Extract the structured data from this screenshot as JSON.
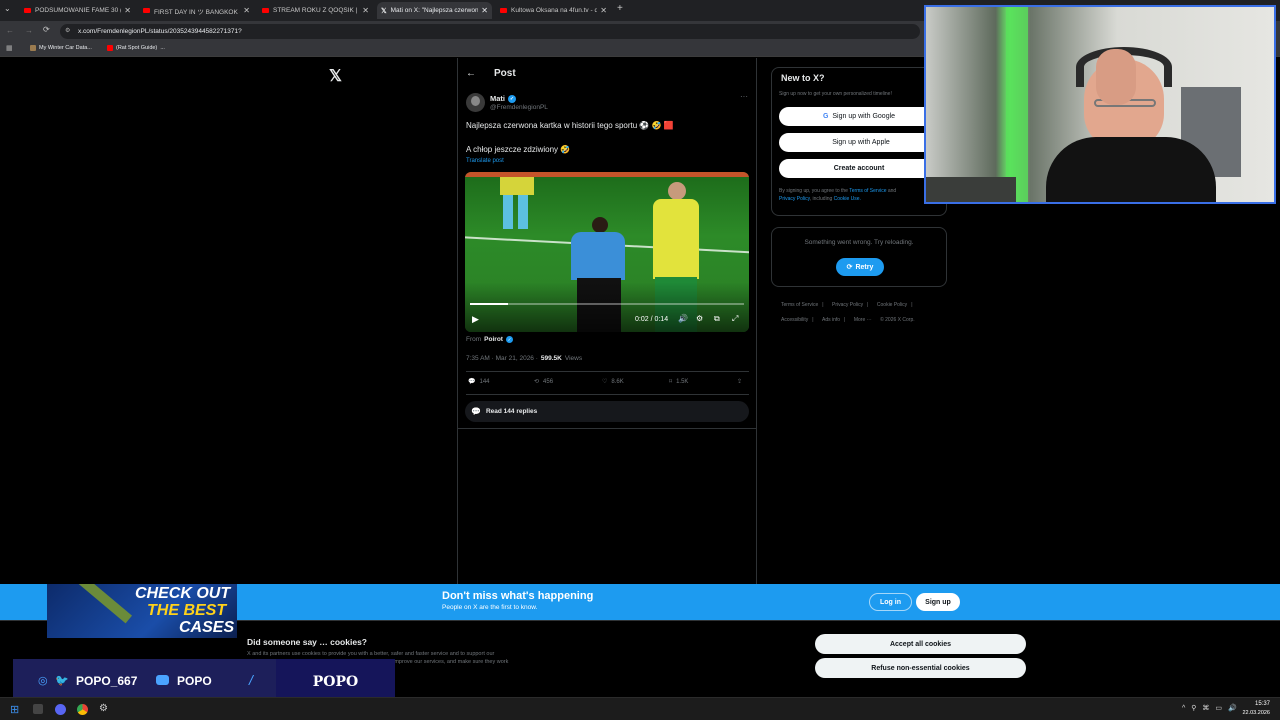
{
  "browser": {
    "tabs": [
      {
        "title": "PODSUMOWANIE FAME 30 (DI",
        "icon": "youtube-icon"
      },
      {
        "title": "FIRST DAY IN ツ BANGKOK - Yo",
        "icon": "youtube-icon"
      },
      {
        "title": "STREAM ROKU Z QOQSIK | WS",
        "icon": "youtube-icon"
      },
      {
        "title": "Mati on X: \"Najlepsza czerwon",
        "icon": "x-logo-icon"
      },
      {
        "title": "Kultowa Oksana na 4fun.tv - dy",
        "icon": "youtube-icon"
      }
    ],
    "url": "x.com/FremdenlegionPL/status/2035243944582271371?",
    "bookmarks": [
      "My Winter Car Data...",
      "(Rat Spot Guide)  ..."
    ]
  },
  "post_header": {
    "title": "Post"
  },
  "tweet": {
    "author": "Mati",
    "handle": "@FremdenlegionPL",
    "text_line1": "Najlepsza czerwona kartka w historii tego sportu ⚽ 🤣 🟥",
    "text_line2": "A chłop jeszcze zdziwiony 🤣",
    "translate": "Translate post",
    "video_time": "0:02 / 0:14",
    "video_progress": 0.14,
    "from_prefix": "From",
    "from_name": "Poirot",
    "timestamp": "7:35 AM · Mar 21, 2026 ·",
    "views_count": "599.5K",
    "views_label": "Views",
    "replies": "144",
    "reposts": "456",
    "likes": "8.6K",
    "bookmarks": "1.5K",
    "read_replies": "Read 144 replies"
  },
  "sidebar": {
    "new_title": "New to X?",
    "new_sub": "Sign up now to get your own personalized timeline!",
    "google": "Sign up with Google",
    "apple": "Sign up with Apple",
    "create": "Create account",
    "legal1": "By signing up, you agree to the",
    "terms": "Terms of Service",
    "and": "and",
    "privacy": "Privacy Policy",
    "including": ", including",
    "cookie_use": "Cookie Use.",
    "error_text": "Something went wrong. Try reloading.",
    "retry": "Retry",
    "footer": [
      "Terms of Service",
      "Privacy Policy",
      "Cookie Policy",
      "Accessibility",
      "Ads info",
      "More ···",
      "© 2026 X Corp."
    ]
  },
  "banner": {
    "title": "Don't miss what's happening",
    "subtitle": "People on X are the first to know.",
    "login": "Log in",
    "signup": "Sign up"
  },
  "cookies": {
    "title": "Did someone say … cookies?",
    "body1": "X and its partners use cookies to provide you with a better, safer and faster service and to support our",
    "body2": "business. Some cookies are necessary to use our services, improve our services, and make sure they work",
    "accept": "Accept all cookies",
    "refuse": "Refuse non-essential cookies"
  },
  "overlay": {
    "ad_line1": "CHECK OUT",
    "ad_line2": "THE BEST",
    "ad_line3": "CASES",
    "social_handle": "POPO_667",
    "yt_name": "POPO",
    "brand": "POPO"
  },
  "taskbar": {
    "time": "15:37",
    "date": "22.03.2026"
  },
  "colors": {
    "x_blue": "#1d9bf0",
    "banner": "#1d9bf0",
    "background": "#000000"
  }
}
